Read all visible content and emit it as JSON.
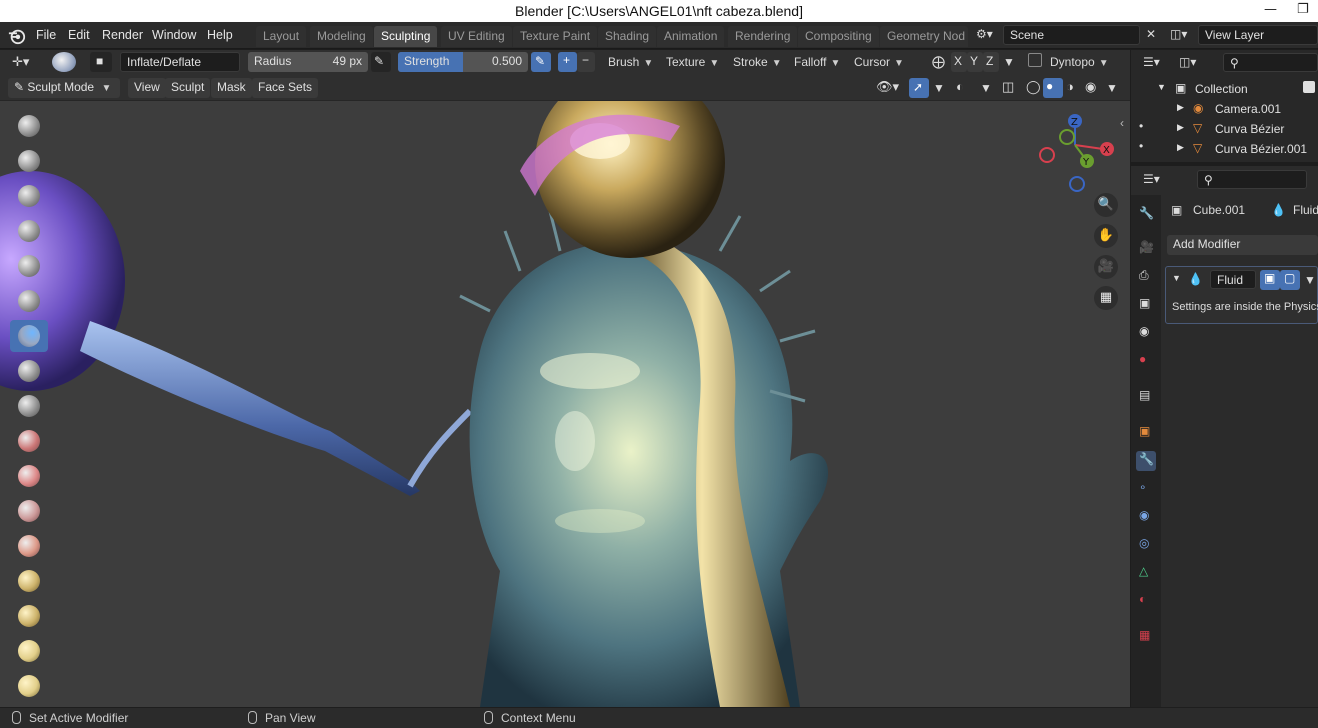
{
  "window": {
    "title": "Blender [C:\\Users\\ANGEL01\\nft cabeza.blend]",
    "minimize_icon": "minimize-icon",
    "restore_icon": "restore-icon"
  },
  "menu": [
    "File",
    "Edit",
    "Render",
    "Window",
    "Help"
  ],
  "workspaces": [
    "Layout",
    "Modeling",
    "Sculpting",
    "UV Editing",
    "Texture Paint",
    "Shading",
    "Animation",
    "Rendering",
    "Compositing",
    "Geometry Nod"
  ],
  "active_workspace": "Sculpting",
  "scene": {
    "label": "Scene"
  },
  "view_layer": {
    "label": "View Layer"
  },
  "tool_header": {
    "brush_name": "Inflate/Deflate",
    "radius_label": "Radius",
    "radius_value": "49 px",
    "strength_label": "Strength",
    "strength_value": "0.500",
    "plus": "+",
    "minus": "−",
    "brush_menu": "Brush",
    "texture_menu": "Texture",
    "stroke_menu": "Stroke",
    "falloff_menu": "Falloff",
    "cursor_menu": "Cursor",
    "axis_x": "X",
    "axis_y": "Y",
    "axis_z": "Z",
    "dyntopo": "Dyntopo"
  },
  "view_header": {
    "mode": "Sculpt Mode",
    "view": "View",
    "sculpt": "Sculpt",
    "mask": "Mask",
    "face_sets": "Face Sets"
  },
  "gizmo": {
    "x": "X",
    "y": "Y",
    "z": "Z"
  },
  "outliner": {
    "rows": [
      {
        "label": "Collection",
        "icon": "collection-icon"
      },
      {
        "label": "Camera.001",
        "icon": "camera-icon"
      },
      {
        "label": "Curva Bézier",
        "icon": "curve-icon"
      },
      {
        "label": "Curva Bézier.001",
        "icon": "curve-icon"
      }
    ]
  },
  "properties": {
    "object_name": "Cube.001",
    "modifier_tab_name": "Fluid",
    "add_modifier": "Add Modifier",
    "modifier_name": "Fluid",
    "info_text": "Settings are inside the Physics"
  },
  "status_bar": {
    "left": "Set Active Modifier",
    "middle": "Pan View",
    "right": "Context Menu"
  },
  "colors": {
    "accent": "#4772b3",
    "background": "#3d3d3d",
    "header": "#2f2f2f"
  }
}
